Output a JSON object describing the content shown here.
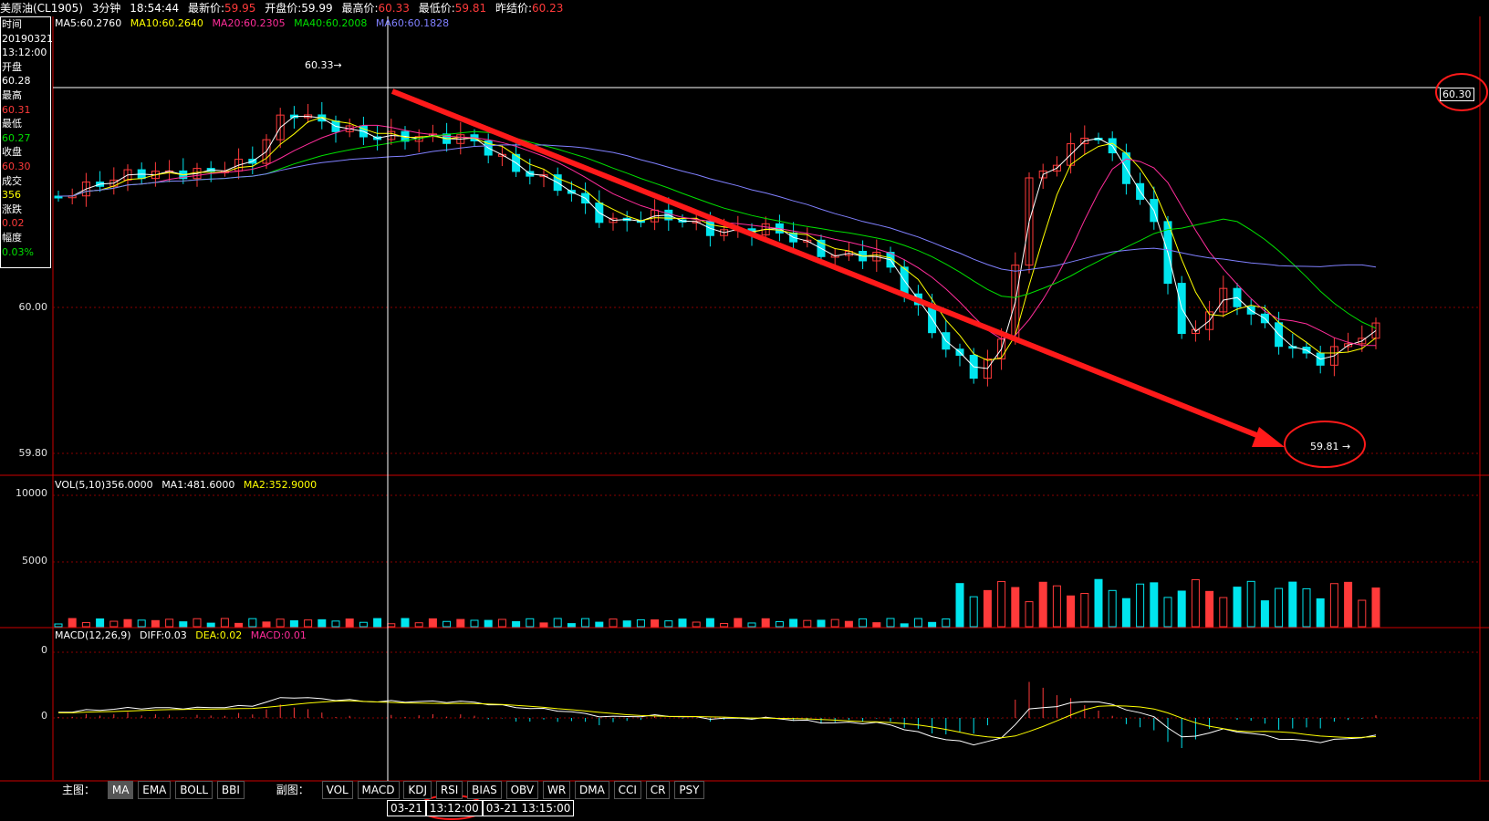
{
  "header": {
    "name": "美原油(CL1905)",
    "period": "3分钟",
    "time": "18:54:44",
    "latest_label": "最新价:",
    "latest": "59.95",
    "open_label": "开盘价:",
    "open": "59.99",
    "high_label": "最高价:",
    "high": "60.33",
    "low_label": "最低价:",
    "low": "59.81",
    "prev_label": "昨结价:",
    "prev": "60.23"
  },
  "ma_legend": [
    {
      "text": "MA5:60.2760",
      "color": "#ffffff"
    },
    {
      "text": "MA10:60.2640",
      "color": "#ffff00"
    },
    {
      "text": "MA20:60.2305",
      "color": "#ff2d9a"
    },
    {
      "text": "MA40:60.2008",
      "color": "#00e000"
    },
    {
      "text": "MA60:60.1828",
      "color": "#8080ff"
    }
  ],
  "info_panel": {
    "time_label": "时间",
    "date": "20190321",
    "time": "13:12:00",
    "open_label": "开盘",
    "open": "60.28",
    "high_label": "最高",
    "high": "60.31",
    "low_label": "最低",
    "low": "60.27",
    "close_label": "收盘",
    "close": "60.30",
    "vol_label": "成交",
    "vol": "356",
    "change_label": "涨跌",
    "change": "0.02",
    "amp_label": "幅度",
    "amp": "0.03%"
  },
  "price_axis": {
    "top_label": "60.00",
    "bottom_label": "59.80"
  },
  "annotations": {
    "high_marker": "60.33",
    "low_marker": "59.81",
    "crosshair_price": "60.30"
  },
  "volume": {
    "legend": [
      {
        "text": "VOL(5,10)356.0000",
        "color": "#ffffff"
      },
      {
        "text": "MA1:481.6000",
        "color": "#ffffff"
      },
      {
        "text": "MA2:352.9000",
        "color": "#ffff00"
      }
    ],
    "axis": [
      "10000",
      "5000"
    ]
  },
  "macd": {
    "legend": [
      {
        "text": "MACD(12,26,9)",
        "color": "#ffffff"
      },
      {
        "text": "DIFF:0.03",
        "color": "#ffffff"
      },
      {
        "text": "DEA:0.02",
        "color": "#ffff00"
      },
      {
        "text": "MACD:0.01",
        "color": "#ff2d9a"
      }
    ],
    "axis": [
      "0",
      "0"
    ]
  },
  "tabs": {
    "main_label": "主图：",
    "main": [
      "MA",
      "EMA",
      "BOLL",
      "BBI"
    ],
    "main_active": "MA",
    "sub_label": "副图：",
    "sub": [
      "VOL",
      "MACD",
      "KDJ",
      "RSI",
      "BIAS",
      "OBV",
      "WR",
      "DMA",
      "CCI",
      "CR",
      "PSY"
    ]
  },
  "time_bar": {
    "date": "03-21",
    "cursor_time": "13:12:00",
    "next": "03-21 13:15:00"
  },
  "colors": {
    "up": "#ff3a3a",
    "down": "#00e5ee",
    "ma5": "#ffffff",
    "ma10": "#ffff00",
    "ma20": "#ff2d9a",
    "ma40": "#00e000",
    "ma60": "#8080ff",
    "trend": "#ff1a1a"
  }
}
